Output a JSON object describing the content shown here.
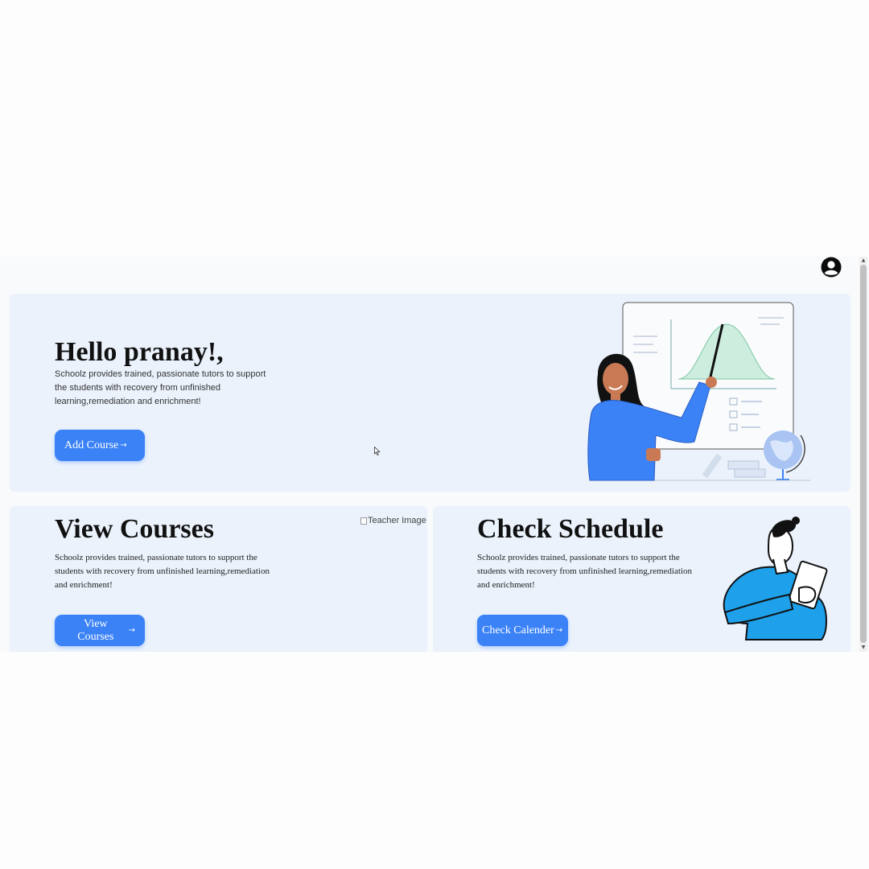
{
  "hero": {
    "greeting": "Hello pranay!,",
    "description": "Schoolz provides trained, passionate tutors to support the students with recovery from unfinished learning,remediation and enrichment!",
    "button_label": "Add Course",
    "button_arrow": "→"
  },
  "courses": {
    "title": "View Courses",
    "description": "Schoolz provides trained, passionate tutors to support the students with recovery from unfinished learning,remediation and enrichment!",
    "button_label": "View Courses",
    "button_arrow": "→",
    "image_alt": "Teacher Image"
  },
  "schedule": {
    "title": "Check Schedule",
    "description": "Schoolz provides trained, passionate tutors to support the students with recovery from unfinished learning,remediation and enrichment!",
    "button_label": "Check Calender",
    "button_arrow": "→"
  },
  "colors": {
    "accent": "#3b82f6",
    "card_background": "#ebf2fc",
    "page_background": "#f8fafc"
  },
  "icons": {
    "profile": "user-circle-icon",
    "scroll_up": "▲",
    "scroll_down": "▼"
  }
}
